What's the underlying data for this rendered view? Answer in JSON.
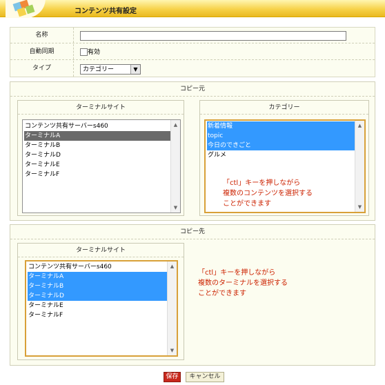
{
  "header": {
    "title": "コンテンツ共有設定"
  },
  "form": {
    "name_label": "名称",
    "name_value": "",
    "autosync_label": "自動同期",
    "autosync_checkbox_label": "有効",
    "type_label": "タイプ",
    "type_selected": "カテゴリー"
  },
  "source": {
    "title": "コピー元",
    "terminal_panel": {
      "title": "ターミナルサイト",
      "items": [
        {
          "label": "コンテンツ共有サーバーs460",
          "selected": false
        },
        {
          "label": "ターミナルA",
          "selected": true
        },
        {
          "label": "ターミナルB",
          "selected": false
        },
        {
          "label": "ターミナルD",
          "selected": false
        },
        {
          "label": "ターミナルE",
          "selected": false
        },
        {
          "label": "ターミナルF",
          "selected": false
        }
      ]
    },
    "category_panel": {
      "title": "カテゴリー",
      "items": [
        {
          "label": "新着情報",
          "selected": true
        },
        {
          "label": "topic",
          "selected": true
        },
        {
          "label": "今日のできごと",
          "selected": true
        },
        {
          "label": "グルメ",
          "selected": false
        }
      ],
      "hint_lines": [
        "「ctl」キーを押しながら",
        "複数のコンテンツを選択する",
        "ことができます"
      ]
    }
  },
  "destination": {
    "title": "コピー先",
    "terminal_panel": {
      "title": "ターミナルサイト",
      "items": [
        {
          "label": "コンテンツ共有サーバーs460",
          "selected": false
        },
        {
          "label": "ターミナルA",
          "selected": true
        },
        {
          "label": "ターミナルB",
          "selected": true
        },
        {
          "label": "ターミナルD",
          "selected": true
        },
        {
          "label": "ターミナルE",
          "selected": false
        },
        {
          "label": "ターミナルF",
          "selected": false
        }
      ]
    },
    "hint_lines": [
      "「ctl」キーを押しながら",
      "複数のターミナルを選択する",
      "ことができます"
    ]
  },
  "buttons": {
    "save": "保存",
    "cancel": "キャンセル"
  },
  "colors": {
    "header_accent": "#f7d24a",
    "selection_blue": "#3399ff",
    "selection_gray": "#6a6a6a",
    "hint_red": "#cc2200",
    "save_red": "#c8281c"
  }
}
